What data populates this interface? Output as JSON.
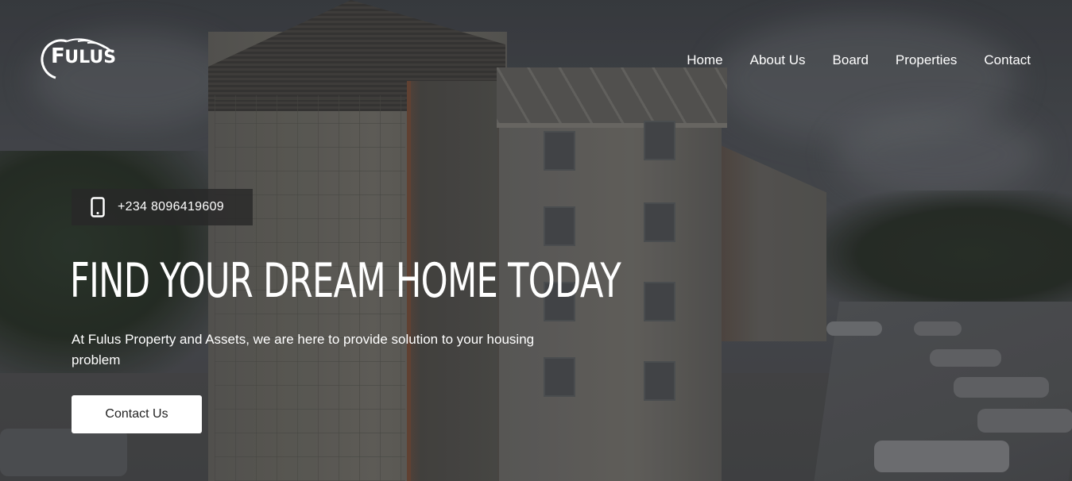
{
  "brand": {
    "logo_text_f": "F",
    "logo_text_rest": "ULUS",
    "color": "#ffffff"
  },
  "nav": {
    "items": [
      {
        "label": "Home"
      },
      {
        "label": "About Us"
      },
      {
        "label": "Board"
      },
      {
        "label": "Properties"
      },
      {
        "label": "Contact"
      }
    ]
  },
  "hero": {
    "phone_icon": "mobile-phone-icon",
    "phone": "+234 8096419609",
    "headline": "FIND YOUR DREAM HOME TODAY",
    "subtext": "At Fulus Property and Assets, we are here to provide solution to your housing problem",
    "cta_label": "Contact Us",
    "background": "office building with parking lot, dark overlay"
  },
  "colors": {
    "text": "#ffffff",
    "button_bg": "#ffffff",
    "button_text": "#222222",
    "badge_bg": "#2a2a2a"
  }
}
